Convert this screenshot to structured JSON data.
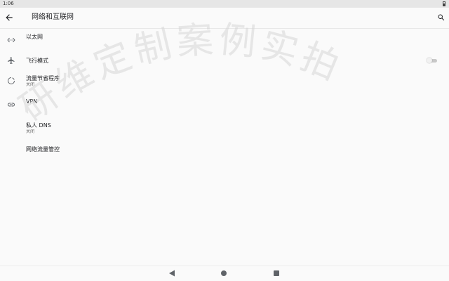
{
  "status_bar": {
    "time": "1:06"
  },
  "app_bar": {
    "title": "网络和互联网"
  },
  "settings": [
    {
      "title": "以太网",
      "icon": "ethernet-icon"
    },
    {
      "title": "飞行模式",
      "icon": "airplane-icon",
      "toggle": false
    },
    {
      "title": "流量节省程序",
      "summary": "关闭",
      "icon": "data-saver-icon"
    },
    {
      "title": "VPN",
      "icon": "vpn-key-icon"
    },
    {
      "title": "私人 DNS",
      "summary": "关闭"
    },
    {
      "title": "网络流量管控"
    }
  ],
  "watermark": {
    "text": "研维定制案例实拍"
  },
  "colors": {
    "background": "#fafafa",
    "status_bar": "#e6e6e6",
    "icon": "#5f6368",
    "watermark": "#d6d6d6"
  }
}
